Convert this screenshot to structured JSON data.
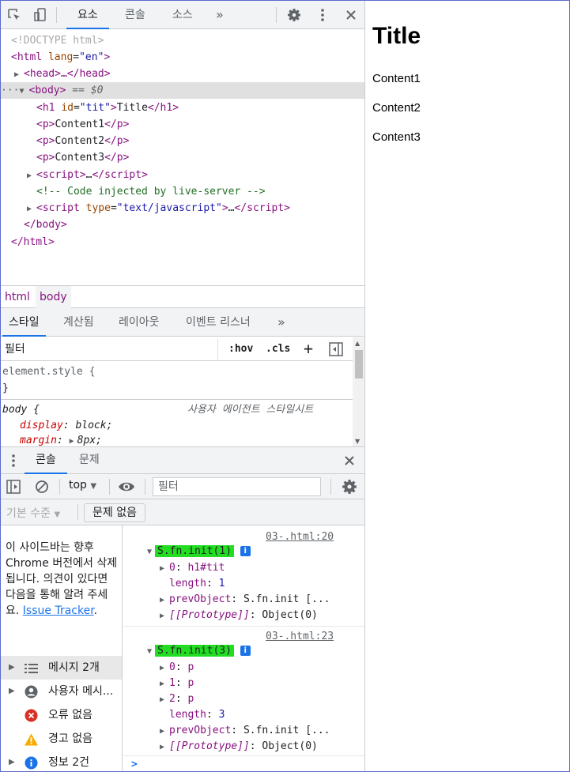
{
  "devtools": {
    "main_tabs": [
      "요소",
      "콘솔",
      "소스"
    ],
    "more_tabs": "»",
    "tree": {
      "doctype": "<!DOCTYPE html>",
      "html_open_tag": "html",
      "html_lang_attr": "lang",
      "html_lang_val": "\"en\"",
      "head_collapsed": "<head>…</head>",
      "body_tag": "body",
      "body_selected_suffix": "== $0",
      "h1_tag": "h1",
      "h1_id_attr": "id",
      "h1_id_val": "\"tit\"",
      "h1_text": "Title",
      "p1_text": "Content1",
      "p2_text": "Content2",
      "p3_text": "Content3",
      "script1": "script",
      "script1_ellipsis": "…",
      "comment": "<!-- Code injected by live-server -->",
      "script2_tag": "script",
      "script2_type_attr": "type",
      "script2_type_val": "\"text/javascript\"",
      "script2_ellipsis": "…",
      "body_close": "</body>",
      "html_close": "</html>",
      "ellipsis_dots": "···"
    },
    "breadcrumb": [
      "html",
      "body"
    ],
    "styles_tabs": [
      "스타일",
      "계산됨",
      "레이아웃",
      "이벤트 리스너"
    ],
    "styles_more": "»",
    "styles_filter_placeholder": "필터",
    "hov": ":hov",
    "cls": ".cls",
    "plus": "+",
    "element_style_selector": "element.style {",
    "element_style_close": "}",
    "body_rule_selector": "body {",
    "body_rule_source": "사용자 에이전트 스타일시트",
    "body_rule_props": [
      {
        "name": "display",
        "value": "block;"
      },
      {
        "name": "margin",
        "value": "8px;"
      }
    ]
  },
  "drawer": {
    "tabs": [
      "콘솔",
      "문제"
    ],
    "context": "top",
    "filter_placeholder": "필터",
    "level": "기본 수준",
    "no_issues": "문제 없음",
    "sidebar_note": "이 사이드바는 향후 Chrome 버전에서 삭제됩니다. 의견이 있다면 다음을 통해 알려 주세요.",
    "sidebar_link": "Issue Tracker",
    "sidebar_period": ".",
    "sidebar_items": [
      {
        "label": "메시지 2개"
      },
      {
        "label": "사용자 메시..."
      },
      {
        "label": "오류 없음"
      },
      {
        "label": "경고 없음"
      },
      {
        "label": "정보 2건"
      }
    ]
  },
  "console": {
    "entry1": {
      "source": "03-.html:20",
      "summary": "S.fn.init(1)",
      "lines": {
        "k0": "0",
        "v0": "h1#tit",
        "length_key": "length",
        "length_val": "1",
        "prev_key": "prevObject",
        "prev_val": "S.fn.init [...",
        "proto_key": "[[Prototype]]",
        "proto_val": "Object(0)"
      }
    },
    "entry2": {
      "source": "03-.html:23",
      "summary": "S.fn.init(3)",
      "lines": {
        "k0": "0",
        "v0": "p",
        "k1": "1",
        "v1": "p",
        "k2": "2",
        "v2": "p",
        "length_key": "length",
        "length_val": "3",
        "prev_key": "prevObject",
        "prev_val": "S.fn.init [...",
        "proto_key": "[[Prototype]]",
        "proto_val": "Object(0)"
      }
    },
    "prompt": ">"
  },
  "page": {
    "title": "Title",
    "paragraphs": [
      "Content1",
      "Content2",
      "Content3"
    ]
  },
  "colors": {
    "accent": "#1a73e8",
    "highlight": "#22dd22",
    "tag": "#881280"
  }
}
